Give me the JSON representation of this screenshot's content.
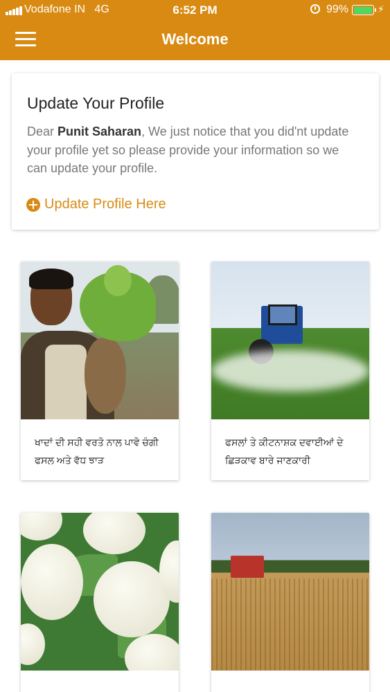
{
  "status_bar": {
    "carrier": "Vodafone IN",
    "network": "4G",
    "time": "6:52 PM",
    "battery_percent": "99%",
    "battery_level": 0.99,
    "battery_color": "#4CD964"
  },
  "header": {
    "title": "Welcome",
    "menu_icon": "hamburger-menu-icon",
    "background_color": "#D98A12"
  },
  "profile_card": {
    "title": "Update Your Profile",
    "greeting": "Dear",
    "user_name": "Punit Saharan",
    "message": ", We just notice that you did'nt update your profile yet so please provide your information so we can update your profile.",
    "action_label": "Update Profile Here",
    "action_icon": "plus-circle-icon",
    "accent_color": "#D98A12"
  },
  "articles": [
    {
      "caption": "ਖਾਦਾਂ ਦੀ ਸਹੀ ਵਰਤੋ ਨਾਲ ਪਾਵੋ ਚੰਗੀ ਫਸਲ ਅਤੇ ਵੱਧ ਝਾੜ",
      "image": "farmer-with-plant-photo"
    },
    {
      "caption": "ਫਸਲਾਂ ਤੇ ਕੀਟਨਾਸ਼ਕ ਦਵਾਈਆਂ ਦੇ ਛਿੜਕਾਵ ਬਾਰੇ ਜਾਣਕਾਰੀ",
      "image": "tractor-spraying-photo"
    },
    {
      "caption": "",
      "image": "cauliflower-photo"
    },
    {
      "caption": "",
      "image": "wheat-field-photo"
    }
  ]
}
